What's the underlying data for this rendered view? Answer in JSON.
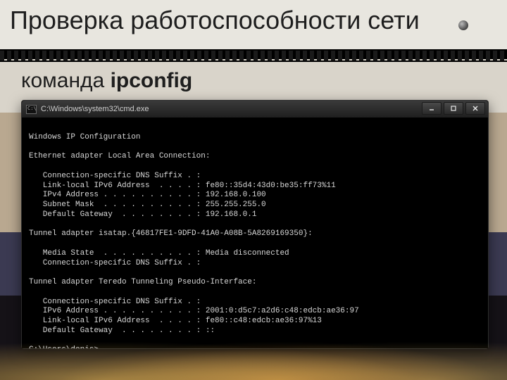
{
  "slide": {
    "title": "Проверка работоспособности сети",
    "subtitle_prefix": "команда ",
    "subtitle_cmd": "ipconfig"
  },
  "window": {
    "title_path": "C:\\Windows\\system32\\cmd.exe",
    "buttons": {
      "min": "minimize",
      "max": "maximize",
      "close": "close"
    }
  },
  "console": {
    "header": "Windows IP Configuration",
    "sections": [
      {
        "title": "Ethernet adapter Local Area Connection:",
        "rows": [
          {
            "label": "Connection-specific DNS Suffix",
            "value": ""
          },
          {
            "label": "Link-local IPv6 Address",
            "value": "fe80::35d4:43d0:be35:ff73%11"
          },
          {
            "label": "IPv4 Address",
            "value": "192.168.0.100"
          },
          {
            "label": "Subnet Mask",
            "value": "255.255.255.0"
          },
          {
            "label": "Default Gateway",
            "value": "192.168.0.1"
          }
        ]
      },
      {
        "title": "Tunnel adapter isatap.{46817FE1-9DFD-41A0-A08B-5A8269169350}:",
        "rows": [
          {
            "label": "Media State",
            "value": "Media disconnected"
          },
          {
            "label": "Connection-specific DNS Suffix",
            "value": ""
          }
        ]
      },
      {
        "title": "Tunnel adapter Teredo Tunneling Pseudo-Interface:",
        "rows": [
          {
            "label": "Connection-specific DNS Suffix",
            "value": ""
          },
          {
            "label": "IPv6 Address",
            "value": "2001:0:d5c7:a2d6:c48:edcb:ae36:97"
          },
          {
            "label": "Link-local IPv6 Address",
            "value": "fe80::c48:edcb:ae36:97%13"
          },
          {
            "label": "Default Gateway",
            "value": "::"
          }
        ]
      }
    ],
    "prompt": "C:\\Users\\denis>"
  }
}
